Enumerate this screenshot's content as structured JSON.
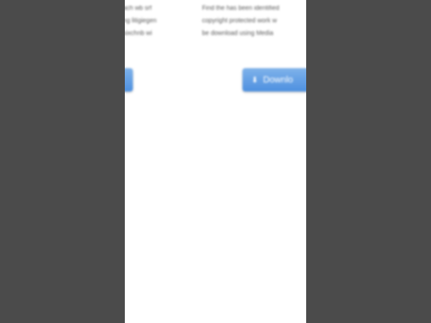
{
  "left_column": {
    "lines": [
      "ach wb srf",
      "ng litigiegen",
      "sixchnb wi"
    ]
  },
  "right_column": {
    "lines": [
      "Find the has been identified",
      "copyright protected work w",
      "be download using Media"
    ]
  },
  "buttons": {
    "left_label": "",
    "download_label": "Downlo",
    "download_icon": "download-icon"
  },
  "colors": {
    "side_pillar": "#4b4b4b",
    "content_bg": "#ffffff",
    "button_blue": "#5b9be4"
  }
}
